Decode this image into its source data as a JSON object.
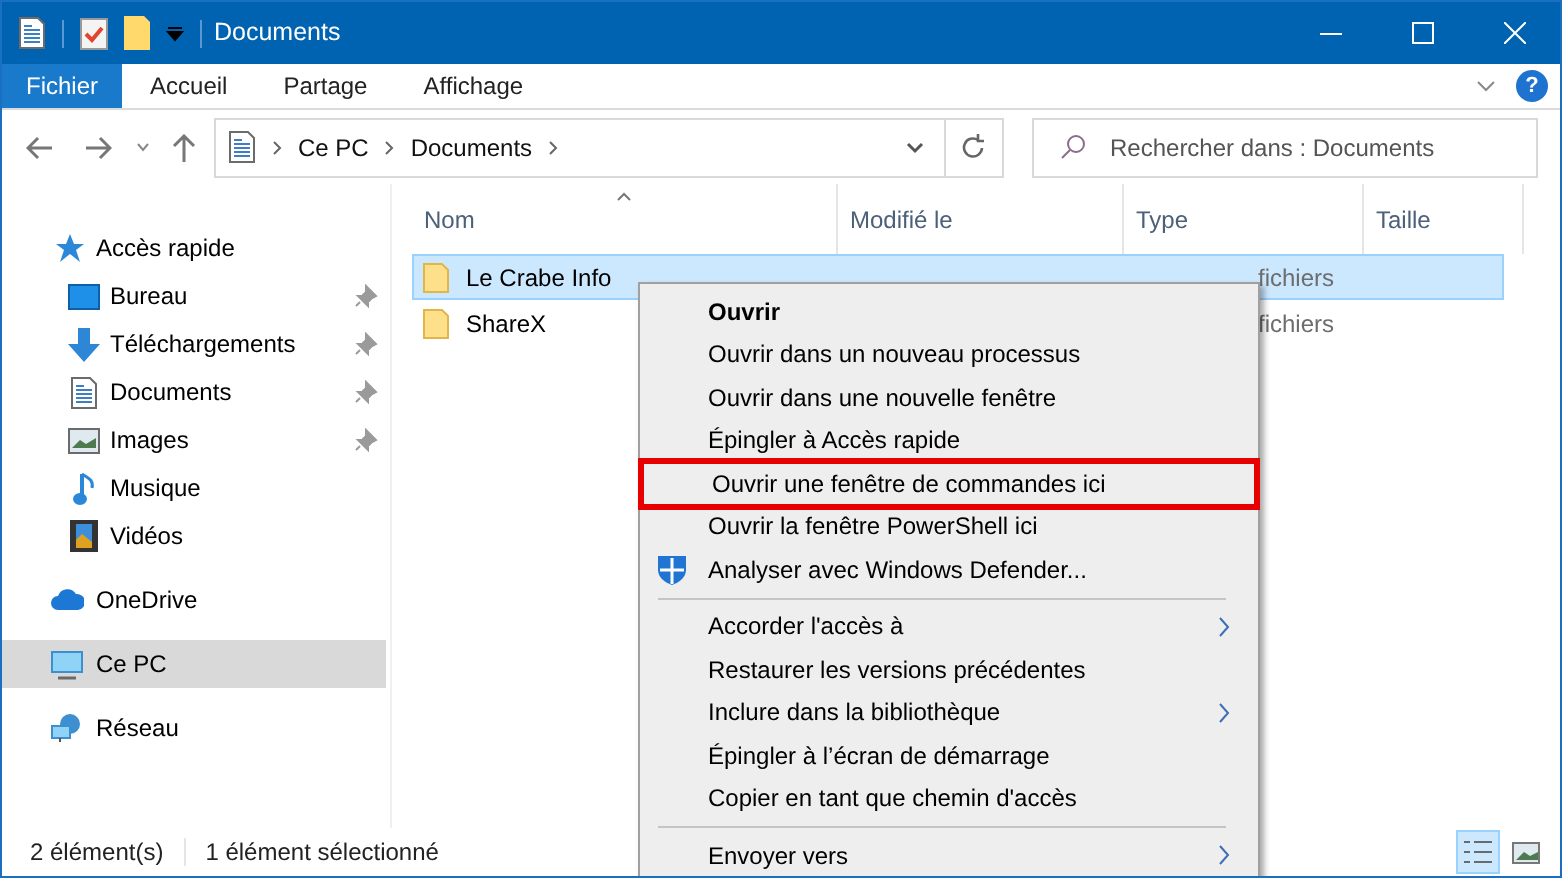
{
  "window": {
    "title": "Documents"
  },
  "ribbon": {
    "tabs": [
      {
        "label": "Fichier",
        "selected": true
      },
      {
        "label": "Accueil",
        "selected": false
      },
      {
        "label": "Partage",
        "selected": false
      },
      {
        "label": "Affichage",
        "selected": false
      }
    ],
    "help": "?"
  },
  "address": {
    "path": [
      "Ce PC",
      "Documents"
    ]
  },
  "search": {
    "placeholder": "Rechercher dans : Documents"
  },
  "sidebar": {
    "groups": [
      {
        "label": "Accès rapide",
        "selected": false,
        "children": [
          {
            "label": "Bureau",
            "pinned": true
          },
          {
            "label": "Téléchargements",
            "pinned": true
          },
          {
            "label": "Documents",
            "pinned": true
          },
          {
            "label": "Images",
            "pinned": true
          },
          {
            "label": "Musique",
            "pinned": false
          },
          {
            "label": "Vidéos",
            "pinned": false
          }
        ]
      },
      {
        "label": "OneDrive",
        "selected": false
      },
      {
        "label": "Ce PC",
        "selected": true
      },
      {
        "label": "Réseau",
        "selected": false
      }
    ]
  },
  "table": {
    "columns": [
      {
        "label": "Nom",
        "sorted": true
      },
      {
        "label": "Modifié le",
        "sorted": false
      },
      {
        "label": "Type",
        "sorted": false
      },
      {
        "label": "Taille",
        "sorted": false
      }
    ],
    "rows": [
      {
        "name": "Le Crabe Info",
        "type": "fichiers",
        "selected": true
      },
      {
        "name": "ShareX",
        "type": "fichiers",
        "selected": false
      }
    ]
  },
  "context_menu": {
    "items": [
      {
        "kind": "item",
        "label": "Ouvrir",
        "default": true,
        "submenu": false,
        "highlighted": false
      },
      {
        "kind": "item",
        "label": "Ouvrir dans un nouveau processus",
        "default": false,
        "submenu": false,
        "highlighted": false
      },
      {
        "kind": "item",
        "label": "Ouvrir dans une nouvelle fenêtre",
        "default": false,
        "submenu": false,
        "highlighted": false
      },
      {
        "kind": "item",
        "label": "Épingler à Accès rapide",
        "default": false,
        "submenu": false,
        "highlighted": false
      },
      {
        "kind": "item",
        "label": "Ouvrir une fenêtre de commandes ici",
        "default": false,
        "submenu": false,
        "highlighted": true
      },
      {
        "kind": "item",
        "label": "Ouvrir la fenêtre PowerShell ici",
        "default": false,
        "submenu": false,
        "highlighted": false
      },
      {
        "kind": "shield",
        "label": "Analyser avec Windows Defender...",
        "default": false,
        "submenu": false,
        "highlighted": false
      },
      {
        "kind": "separator"
      },
      {
        "kind": "item",
        "label": "Accorder l'accès à",
        "default": false,
        "submenu": true,
        "highlighted": false
      },
      {
        "kind": "item",
        "label": "Restaurer les versions précédentes",
        "default": false,
        "submenu": false,
        "highlighted": false
      },
      {
        "kind": "item",
        "label": "Inclure dans la bibliothèque",
        "default": false,
        "submenu": true,
        "highlighted": false
      },
      {
        "kind": "item",
        "label": "Épingler à l’écran de démarrage",
        "default": false,
        "submenu": false,
        "highlighted": false
      },
      {
        "kind": "item",
        "label": "Copier en tant que chemin d'accès",
        "default": false,
        "submenu": false,
        "highlighted": false
      },
      {
        "kind": "separator"
      },
      {
        "kind": "item",
        "label": "Envoyer vers",
        "default": false,
        "submenu": true,
        "highlighted": false
      }
    ]
  },
  "status_bar": {
    "count": "2 élément(s)",
    "selection": "1 élément sélectionné"
  },
  "view_buttons": [
    {
      "selected": true
    },
    {
      "selected": false
    }
  ]
}
